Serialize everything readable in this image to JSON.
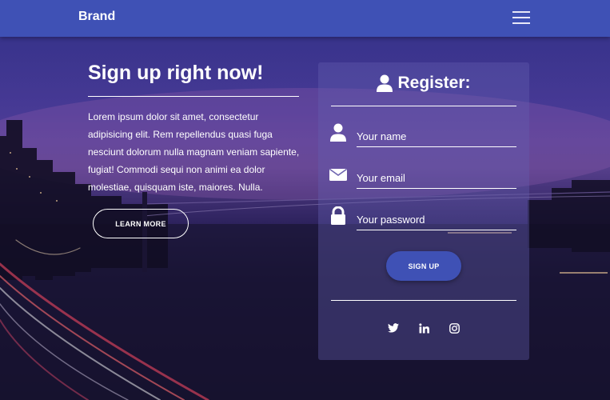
{
  "navbar": {
    "brand": "Brand",
    "menu_icon": "hamburger-menu-icon",
    "color": "#3f51b5"
  },
  "hero": {
    "title": "Sign up right now!",
    "text": "Lorem ipsum dolor sit amet, consectetur adipisicing elit. Rem repellendus quasi fuga nesciunt dolorum nulla magnam veniam sapiente, fugiat! Commodi sequi non animi ea dolor molestiae, quisquam iste, maiores. Nulla.",
    "button_label": "LEARN MORE"
  },
  "register": {
    "title": "Register:",
    "title_icon": "user-icon",
    "fields": [
      {
        "icon": "user-icon",
        "placeholder": "Your name",
        "value": ""
      },
      {
        "icon": "envelope-icon",
        "placeholder": "Your email",
        "value": ""
      },
      {
        "icon": "lock-icon",
        "placeholder": "Your password",
        "value": ""
      }
    ],
    "submit_label": "SIGN UP",
    "social": [
      "twitter-icon",
      "linkedin-icon",
      "instagram-icon"
    ]
  },
  "colors": {
    "primary": "#3f51b5",
    "text": "#ffffff"
  }
}
